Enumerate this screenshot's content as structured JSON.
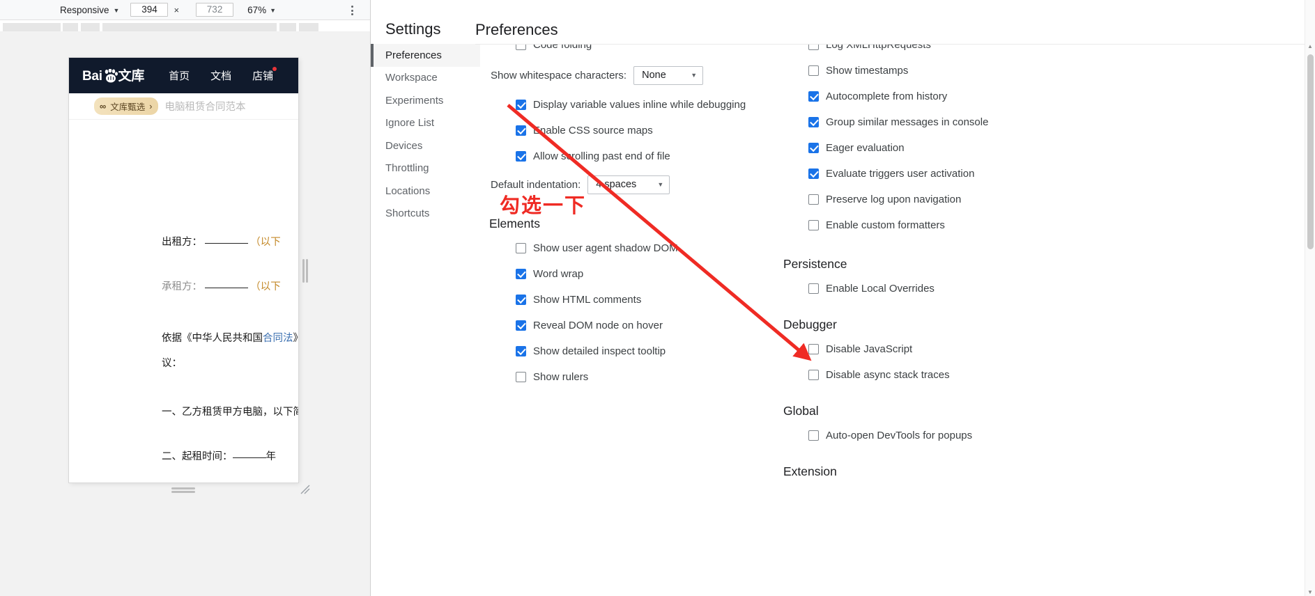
{
  "device_toolbar": {
    "device_select": "Responsive",
    "device_caret": "▼",
    "width_value": "394",
    "height_value": "732",
    "dimension_separator": "×",
    "zoom_value": "67%",
    "zoom_caret": "▼"
  },
  "page_preview": {
    "brand": "Bai",
    "brand_suffix": "文库",
    "nav": [
      {
        "label": "首页",
        "badge": false
      },
      {
        "label": "文档",
        "badge": false
      },
      {
        "label": "店铺",
        "badge": true
      }
    ],
    "chip": {
      "icon": "∞",
      "label": "文库甄选",
      "chevron": "›"
    },
    "doc_title": "电脑租赁合同范本",
    "doc_lines": [
      {
        "label": "出租方：",
        "tail": "（以下"
      },
      {
        "label": "承租方：",
        "tail": "（以下"
      }
    ],
    "doc_body_1a": "依据《中华人民共和国",
    "doc_body_1b": "合同法",
    "doc_body_1c": "》",
    "doc_body_2": "议：",
    "doc_body_3": "一、乙方租赁甲方电脑，以下简",
    "doc_body_4a": "二、起租时间：",
    "doc_body_4b": "年"
  },
  "settings": {
    "title": "Settings",
    "tabs": [
      {
        "label": "Preferences",
        "active": true
      },
      {
        "label": "Workspace",
        "active": false
      },
      {
        "label": "Experiments",
        "active": false
      },
      {
        "label": "Ignore List",
        "active": false
      },
      {
        "label": "Devices",
        "active": false
      },
      {
        "label": "Throttling",
        "active": false
      },
      {
        "label": "Locations",
        "active": false
      },
      {
        "label": "Shortcuts",
        "active": false
      }
    ],
    "pane_title": "Preferences",
    "middle_column": {
      "partial_top_item": {
        "label": "Code folding",
        "checked": false
      },
      "whitespace_label": "Show whitespace characters:",
      "whitespace_value": "None",
      "sources_items": [
        {
          "label": "Display variable values inline while debugging",
          "checked": true
        },
        {
          "label": "Enable CSS source maps",
          "checked": true
        },
        {
          "label": "Allow scrolling past end of file",
          "checked": true
        }
      ],
      "indentation_label": "Default indentation:",
      "indentation_value": "4 spaces",
      "elements_heading": "Elements",
      "elements_items": [
        {
          "label": "Show user agent shadow DOM",
          "checked": false
        },
        {
          "label": "Word wrap",
          "checked": true
        },
        {
          "label": "Show HTML comments",
          "checked": true
        },
        {
          "label": "Reveal DOM node on hover",
          "checked": true
        },
        {
          "label": "Show detailed inspect tooltip",
          "checked": true
        },
        {
          "label": "Show rulers",
          "checked": false
        }
      ]
    },
    "right_column": {
      "partial_top_item": {
        "label": "Log XMLHttpRequests",
        "checked": false
      },
      "console_items": [
        {
          "label": "Show timestamps",
          "checked": false
        },
        {
          "label": "Autocomplete from history",
          "checked": true
        },
        {
          "label": "Group similar messages in console",
          "checked": true
        },
        {
          "label": "Eager evaluation",
          "checked": true
        },
        {
          "label": "Evaluate triggers user activation",
          "checked": true
        },
        {
          "label": "Preserve log upon navigation",
          "checked": false
        },
        {
          "label": "Enable custom formatters",
          "checked": false
        }
      ],
      "persistence_heading": "Persistence",
      "persistence_items": [
        {
          "label": "Enable Local Overrides",
          "checked": false
        }
      ],
      "debugger_heading": "Debugger",
      "debugger_items": [
        {
          "label": "Disable JavaScript",
          "checked": false
        },
        {
          "label": "Disable async stack traces",
          "checked": false
        }
      ],
      "global_heading": "Global",
      "global_items": [
        {
          "label": "Auto-open DevTools for popups",
          "checked": false
        }
      ],
      "extension_heading": "Extension"
    }
  },
  "annotation": {
    "text": "勾选一下",
    "color": "#ef2b24"
  },
  "colors": {
    "accent_blue": "#1a73e8",
    "annotation_red": "#ef2b24",
    "baidu_header": "#101a2c",
    "chip_gold": "#ecd5a6"
  }
}
